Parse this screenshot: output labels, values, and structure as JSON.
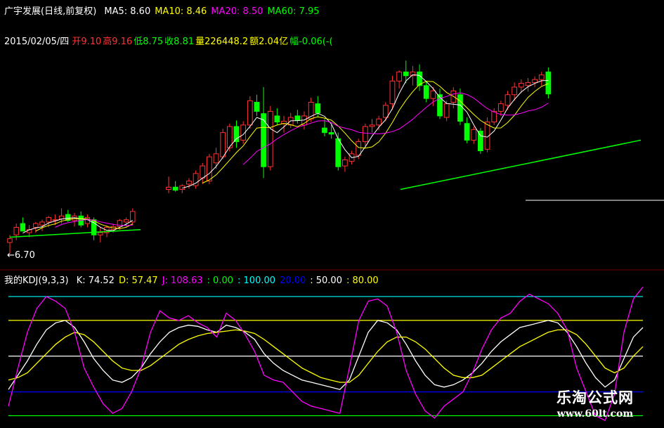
{
  "header": {
    "title": "广宇发展(日线,前复权)",
    "ma": [
      {
        "label": "MA5: 8.60",
        "color": "#ffffff"
      },
      {
        "label": "MA10: 8.46",
        "color": "#ffff00"
      },
      {
        "label": "MA20: 8.50",
        "color": "#ff00ff"
      },
      {
        "label": "MA60: 7.95",
        "color": "#00ff00"
      }
    ],
    "quote": [
      {
        "label": "2015/02/05/四",
        "color": "#ffffff"
      },
      {
        "label": "开9.10",
        "color": "#ff3232"
      },
      {
        "label": "高9.16",
        "color": "#ff3232"
      },
      {
        "label": "低8.75",
        "color": "#00ff00"
      },
      {
        "label": "收8.81",
        "color": "#00ff00"
      },
      {
        "label": "量226448.2",
        "color": "#ffff00"
      },
      {
        "label": "额2.04亿",
        "color": "#ffff00"
      },
      {
        "label": "幅-0.06(-(",
        "color": "#00ff00"
      }
    ],
    "low_marker": "←6.70"
  },
  "kdj": {
    "title": "我的KDJ(9,3,3)",
    "values": [
      {
        "label": "K: 74.52",
        "color": "#ffffff"
      },
      {
        "label": "D: 57.47",
        "color": "#ffff00"
      },
      {
        "label": "J: 108.63",
        "color": "#ff00ff"
      },
      {
        "label": ": 0.00",
        "color": "#00ff00"
      },
      {
        "label": ": 100.00",
        "color": "#00ffff"
      },
      {
        "label": "20.00",
        "color": "#0000ff"
      },
      {
        "label": ": 50.00",
        "color": "#ffffff"
      },
      {
        "label": ": 80.00",
        "color": "#ffff00"
      }
    ]
  },
  "watermark": {
    "line1": "乐淘公式网",
    "line2": "www.60lt.com"
  },
  "colors": {
    "up": "#ff3232",
    "down": "#00ff00",
    "k": "#ffffff",
    "d": "#ffff00",
    "j": "#ff00ff",
    "ma60": "#00ff00",
    "divider": "#7a0000"
  },
  "chart_data": [
    {
      "type": "candlestick",
      "title": "广宇发展(日线,前复权)",
      "annotation": "←6.70",
      "ylim": [
        6.6,
        9.4
      ],
      "candles": [
        {
          "o": 6.85,
          "h": 6.95,
          "l": 6.7,
          "c": 6.9
        },
        {
          "o": 6.95,
          "h": 7.1,
          "l": 6.88,
          "c": 7.05
        },
        {
          "o": 7.1,
          "h": 7.18,
          "l": 7.0,
          "c": 7.0
        },
        {
          "o": 6.98,
          "h": 7.08,
          "l": 6.92,
          "c": 7.02
        },
        {
          "o": 7.05,
          "h": 7.12,
          "l": 6.98,
          "c": 7.1
        },
        {
          "o": 7.08,
          "h": 7.15,
          "l": 7.0,
          "c": 7.12
        },
        {
          "o": 7.12,
          "h": 7.2,
          "l": 7.05,
          "c": 7.18
        },
        {
          "o": 7.15,
          "h": 7.22,
          "l": 7.08,
          "c": 7.15
        },
        {
          "o": 7.16,
          "h": 7.3,
          "l": 7.1,
          "c": 7.2
        },
        {
          "o": 7.22,
          "h": 7.28,
          "l": 7.12,
          "c": 7.14
        },
        {
          "o": 7.14,
          "h": 7.24,
          "l": 7.06,
          "c": 7.2
        },
        {
          "o": 7.2,
          "h": 7.26,
          "l": 7.05,
          "c": 7.08
        },
        {
          "o": 7.1,
          "h": 7.22,
          "l": 7.05,
          "c": 7.18
        },
        {
          "o": 7.15,
          "h": 7.18,
          "l": 6.88,
          "c": 6.95
        },
        {
          "o": 6.95,
          "h": 7.05,
          "l": 6.85,
          "c": 6.98
        },
        {
          "o": 6.98,
          "h": 7.08,
          "l": 6.92,
          "c": 7.05
        },
        {
          "o": 7.02,
          "h": 7.1,
          "l": 6.98,
          "c": 7.06
        },
        {
          "o": 7.06,
          "h": 7.16,
          "l": 7.02,
          "c": 7.14
        },
        {
          "o": 7.12,
          "h": 7.18,
          "l": 7.06,
          "c": 7.15
        },
        {
          "o": 7.12,
          "h": 7.3,
          "l": 7.08,
          "c": 7.26
        }
      ],
      "candles_2": [
        {
          "o": 7.55,
          "h": 7.72,
          "l": 7.5,
          "c": 7.58
        },
        {
          "o": 7.58,
          "h": 7.66,
          "l": 7.52,
          "c": 7.54
        },
        {
          "o": 7.55,
          "h": 7.62,
          "l": 7.5,
          "c": 7.6
        },
        {
          "o": 7.62,
          "h": 7.7,
          "l": 7.56,
          "c": 7.66
        },
        {
          "o": 7.6,
          "h": 7.8,
          "l": 7.56,
          "c": 7.76
        },
        {
          "o": 7.7,
          "h": 7.9,
          "l": 7.62,
          "c": 7.86
        },
        {
          "o": 7.66,
          "h": 8.02,
          "l": 7.62,
          "c": 7.98
        },
        {
          "o": 7.9,
          "h": 8.1,
          "l": 7.82,
          "c": 8.02
        },
        {
          "o": 7.98,
          "h": 8.35,
          "l": 7.95,
          "c": 8.3
        },
        {
          "o": 8.1,
          "h": 8.42,
          "l": 8.05,
          "c": 8.38
        },
        {
          "o": 8.38,
          "h": 8.46,
          "l": 8.1,
          "c": 8.18
        },
        {
          "o": 8.2,
          "h": 8.45,
          "l": 8.15,
          "c": 8.4
        },
        {
          "o": 8.4,
          "h": 8.78,
          "l": 8.35,
          "c": 8.72
        },
        {
          "o": 8.7,
          "h": 8.8,
          "l": 8.52,
          "c": 8.58
        },
        {
          "o": 8.55,
          "h": 8.9,
          "l": 7.7,
          "c": 7.85
        },
        {
          "o": 7.85,
          "h": 8.65,
          "l": 7.8,
          "c": 8.58
        },
        {
          "o": 8.52,
          "h": 8.62,
          "l": 8.4,
          "c": 8.44
        },
        {
          "o": 8.42,
          "h": 8.52,
          "l": 8.3,
          "c": 8.45
        },
        {
          "o": 8.4,
          "h": 8.56,
          "l": 8.36,
          "c": 8.5
        },
        {
          "o": 8.52,
          "h": 8.6,
          "l": 8.42,
          "c": 8.46
        },
        {
          "o": 8.4,
          "h": 8.58,
          "l": 8.34,
          "c": 8.52
        },
        {
          "o": 8.48,
          "h": 8.76,
          "l": 8.44,
          "c": 8.7
        },
        {
          "o": 8.68,
          "h": 8.78,
          "l": 8.5,
          "c": 8.56
        },
        {
          "o": 8.36,
          "h": 8.48,
          "l": 8.25,
          "c": 8.3
        },
        {
          "o": 8.3,
          "h": 8.4,
          "l": 8.22,
          "c": 8.28
        },
        {
          "o": 8.22,
          "h": 8.3,
          "l": 7.8,
          "c": 7.85
        },
        {
          "o": 7.86,
          "h": 7.98,
          "l": 7.78,
          "c": 7.94
        },
        {
          "o": 7.92,
          "h": 8.06,
          "l": 7.88,
          "c": 8.02
        },
        {
          "o": 8.0,
          "h": 8.22,
          "l": 7.95,
          "c": 8.18
        },
        {
          "o": 8.18,
          "h": 8.42,
          "l": 8.12,
          "c": 8.38
        },
        {
          "o": 8.38,
          "h": 8.48,
          "l": 8.3,
          "c": 8.4
        },
        {
          "o": 8.4,
          "h": 8.52,
          "l": 8.33,
          "c": 8.48
        },
        {
          "o": 8.5,
          "h": 8.7,
          "l": 8.45,
          "c": 8.66
        },
        {
          "o": 8.68,
          "h": 9.05,
          "l": 8.6,
          "c": 8.98
        },
        {
          "o": 8.98,
          "h": 9.12,
          "l": 8.88,
          "c": 9.1
        },
        {
          "o": 9.1,
          "h": 9.25,
          "l": 8.95,
          "c": 9.05
        },
        {
          "o": 9.05,
          "h": 9.18,
          "l": 8.92,
          "c": 9.1
        },
        {
          "o": 9.1,
          "h": 9.2,
          "l": 8.85,
          "c": 8.92
        },
        {
          "o": 8.92,
          "h": 8.98,
          "l": 8.7,
          "c": 8.75
        },
        {
          "o": 8.75,
          "h": 8.9,
          "l": 8.65,
          "c": 8.85
        },
        {
          "o": 8.8,
          "h": 8.88,
          "l": 8.48,
          "c": 8.52
        },
        {
          "o": 8.5,
          "h": 8.72,
          "l": 8.45,
          "c": 8.68
        },
        {
          "o": 8.7,
          "h": 8.9,
          "l": 8.62,
          "c": 8.85
        },
        {
          "o": 8.8,
          "h": 8.88,
          "l": 8.4,
          "c": 8.45
        },
        {
          "o": 8.42,
          "h": 8.5,
          "l": 8.16,
          "c": 8.2
        },
        {
          "o": 8.2,
          "h": 8.38,
          "l": 8.15,
          "c": 8.34
        },
        {
          "o": 8.32,
          "h": 8.36,
          "l": 8.02,
          "c": 8.06
        },
        {
          "o": 8.08,
          "h": 8.5,
          "l": 8.04,
          "c": 8.44
        },
        {
          "o": 8.44,
          "h": 8.62,
          "l": 8.4,
          "c": 8.58
        },
        {
          "o": 8.58,
          "h": 8.72,
          "l": 8.52,
          "c": 8.68
        },
        {
          "o": 8.66,
          "h": 8.85,
          "l": 8.6,
          "c": 8.8
        },
        {
          "o": 8.8,
          "h": 8.96,
          "l": 8.72,
          "c": 8.9
        },
        {
          "o": 8.9,
          "h": 9.0,
          "l": 8.82,
          "c": 8.95
        },
        {
          "o": 8.92,
          "h": 9.02,
          "l": 8.84,
          "c": 8.96
        },
        {
          "o": 8.96,
          "h": 9.04,
          "l": 8.9,
          "c": 9.0
        },
        {
          "o": 9.0,
          "h": 9.1,
          "l": 8.92,
          "c": 9.06
        },
        {
          "o": 9.1,
          "h": 9.16,
          "l": 8.75,
          "c": 8.81
        }
      ],
      "ma_series": [
        {
          "name": "MA5",
          "value": 8.6
        },
        {
          "name": "MA10",
          "value": 8.46
        },
        {
          "name": "MA20",
          "value": 8.5
        },
        {
          "name": "MA60",
          "value": 7.95
        }
      ]
    },
    {
      "type": "line",
      "title": "我的KDJ(9,3,3)",
      "ylim": [
        -5,
        110
      ],
      "reference_lines": [
        0,
        20,
        50,
        80,
        100
      ],
      "series": [
        {
          "name": "K",
          "values": [
            22,
            34,
            46,
            60,
            72,
            78,
            80,
            74,
            62,
            48,
            38,
            30,
            28,
            32,
            40,
            52,
            62,
            70,
            74,
            76,
            75,
            72,
            70,
            76,
            74,
            70,
            64,
            52,
            44,
            38,
            34,
            30,
            28,
            26,
            24,
            22,
            30,
            50,
            70,
            80,
            78,
            72,
            60,
            46,
            34,
            26,
            24,
            26,
            30,
            36,
            44,
            54,
            62,
            68,
            74,
            76,
            78,
            80,
            78,
            70,
            58,
            44,
            32,
            24,
            30,
            48,
            66,
            74
          ]
        },
        {
          "name": "D",
          "values": [
            30,
            32,
            36,
            44,
            52,
            60,
            66,
            70,
            68,
            62,
            54,
            46,
            40,
            38,
            38,
            42,
            48,
            54,
            60,
            64,
            67,
            69,
            70,
            71,
            72,
            71,
            69,
            64,
            58,
            52,
            46,
            40,
            36,
            32,
            30,
            28,
            28,
            34,
            44,
            54,
            62,
            66,
            66,
            62,
            56,
            48,
            40,
            34,
            32,
            32,
            34,
            40,
            46,
            52,
            58,
            62,
            66,
            70,
            72,
            72,
            68,
            60,
            50,
            40,
            36,
            40,
            50,
            58
          ]
        },
        {
          "name": "J",
          "values": [
            8,
            40,
            70,
            90,
            100,
            96,
            90,
            70,
            40,
            24,
            10,
            2,
            6,
            20,
            40,
            70,
            88,
            82,
            80,
            84,
            78,
            74,
            66,
            86,
            80,
            68,
            54,
            34,
            30,
            28,
            20,
            12,
            8,
            6,
            4,
            2,
            40,
            80,
            96,
            98,
            92,
            70,
            38,
            18,
            4,
            -2,
            8,
            14,
            20,
            36,
            56,
            72,
            82,
            86,
            96,
            102,
            98,
            94,
            86,
            72,
            40,
            20,
            0,
            -4,
            18,
            70,
            98,
            108
          ]
        }
      ]
    }
  ]
}
